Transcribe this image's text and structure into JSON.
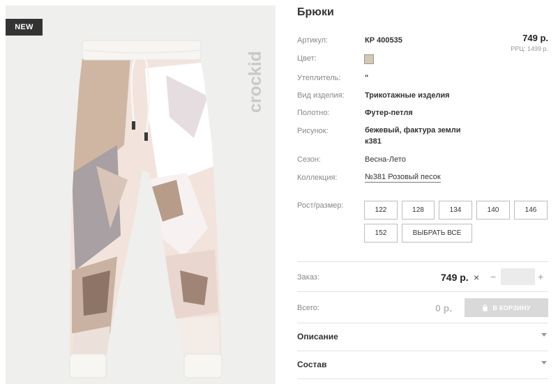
{
  "product": {
    "badge": "NEW",
    "brand": "crockid",
    "title": "Брюки"
  },
  "price": {
    "current": "749 р.",
    "rrp": "РРЦ: 1499 р."
  },
  "attributes": {
    "article_label": "Артикул:",
    "article_value": "КР 400535",
    "color_label": "Цвет:",
    "color_swatch": "#d3c8b0",
    "insulation_label": "Утеплитель:",
    "insulation_value": "\"",
    "type_label": "Вид изделия:",
    "type_value": "Трикотажные изделия",
    "fabric_label": "Полотно:",
    "fabric_value": "Футер-петля",
    "pattern_label": "Рисунок:",
    "pattern_value": "бежевый, фактура земли к381",
    "season_label": "Сезон:",
    "season_value": "Весна-Лето",
    "collection_label": "Коллекция:",
    "collection_value": "№381 Розовый песок"
  },
  "sizes": {
    "label": "Рост/размер:",
    "options": [
      "122",
      "128",
      "134",
      "140",
      "146",
      "152"
    ],
    "select_all": "ВЫБРАТЬ ВСЕ"
  },
  "order": {
    "label": "Заказ:",
    "price": "749 р.",
    "quantity": ""
  },
  "total": {
    "label": "Всего:",
    "amount": "0 р.",
    "cart_button": "В КОРЗИНУ"
  },
  "accordions": {
    "description": "Описание",
    "composition": "Состав"
  }
}
